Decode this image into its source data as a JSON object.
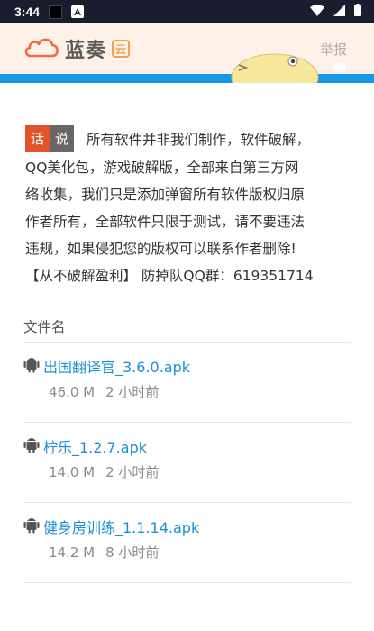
{
  "status_bar": {
    "time": "3:44",
    "icons": [
      "notification-square-icon",
      "a-badge-icon",
      "wifi-icon",
      "signal-icon",
      "battery-icon"
    ]
  },
  "header": {
    "logo_text": "蓝奏",
    "logo_badge": "云",
    "report_label": "举报"
  },
  "notice": {
    "tag_left": "话",
    "tag_right": "说",
    "lines": [
      "所有软件并非我们制作，软件破解，",
      "QQ美化包，游戏破解版，全部来自第三方网",
      "络收集，我们只是添加弹窗所有软件版权归原",
      "作者所有，全部软件只限于测试，请不要违法",
      "违规，如果侵犯您的版权可以联系作者删除!",
      "【从不破解盈利】 防掉队QQ群：619351714"
    ]
  },
  "file_list": {
    "header": "文件名",
    "items": [
      {
        "name": "出国翻译官_3.6.0.apk",
        "size": "46.0 M",
        "time": "2 小时前"
      },
      {
        "name": "柠乐_1.2.7.apk",
        "size": "14.0 M",
        "time": "2 小时前"
      },
      {
        "name": "健身房训练_1.1.14.apk",
        "size": "14.2 M",
        "time": "8 小时前"
      }
    ]
  },
  "colors": {
    "accent_blue": "#1797e4",
    "link_blue": "#1a8fd4",
    "tag_red": "#e1532b",
    "tag_gray": "#6a6665",
    "logo_orange": "#f26b3a"
  }
}
